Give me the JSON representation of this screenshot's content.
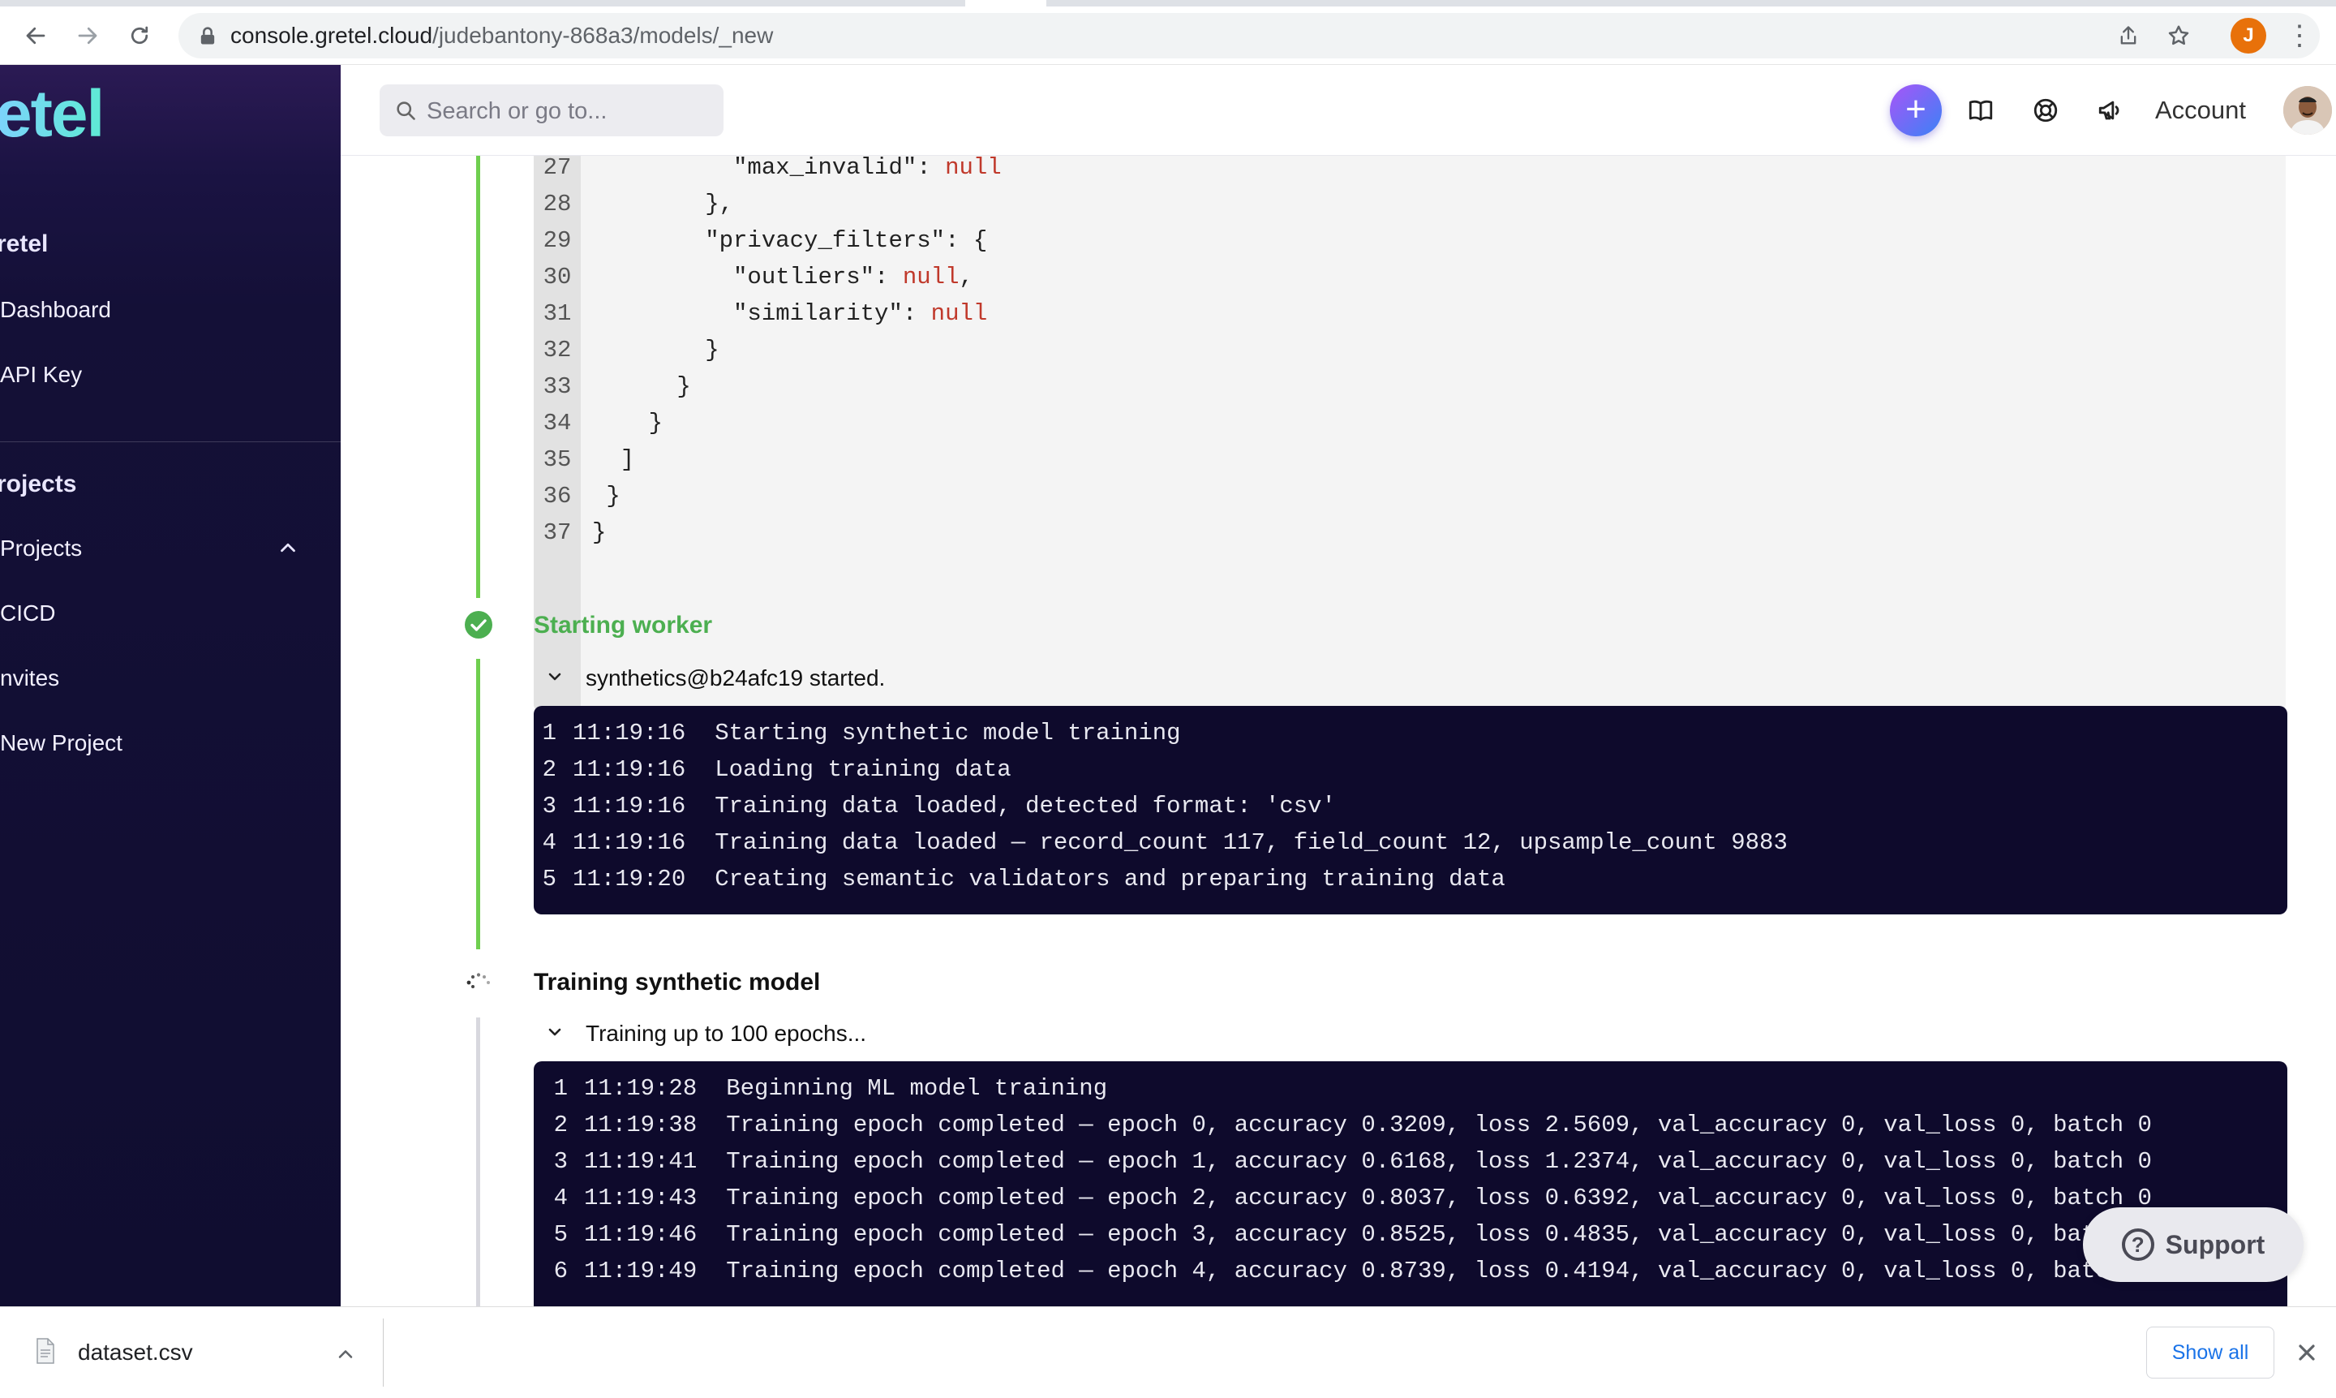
{
  "browser": {
    "url_host": "console.gretel.cloud",
    "url_path": "/judebantony-868a3/models/_new",
    "profile_initial": "J"
  },
  "sidebar": {
    "logo_text": "etel",
    "org_heading": "retel",
    "org_items": [
      "Dashboard",
      "API Key"
    ],
    "projects_heading": "rojects",
    "project_items": [
      "Projects",
      "CICD",
      "nvites",
      "New Project"
    ]
  },
  "header": {
    "search_placeholder": "Search or go to...",
    "plus_label": "+",
    "account_label": "Account"
  },
  "config_code": {
    "lines": [
      {
        "n": "27",
        "pre": "          \"max_invalid\": ",
        "null": "null",
        "post": ""
      },
      {
        "n": "28",
        "pre": "        },",
        "null": "",
        "post": ""
      },
      {
        "n": "29",
        "pre": "        \"privacy_filters\": {",
        "null": "",
        "post": ""
      },
      {
        "n": "30",
        "pre": "          \"outliers\": ",
        "null": "null",
        "post": ","
      },
      {
        "n": "31",
        "pre": "          \"similarity\": ",
        "null": "null",
        "post": ""
      },
      {
        "n": "32",
        "pre": "        }",
        "null": "",
        "post": ""
      },
      {
        "n": "33",
        "pre": "      }",
        "null": "",
        "post": ""
      },
      {
        "n": "34",
        "pre": "    }",
        "null": "",
        "post": ""
      },
      {
        "n": "35",
        "pre": "  ]",
        "null": "",
        "post": ""
      },
      {
        "n": "36",
        "pre": " }",
        "null": "",
        "post": ""
      },
      {
        "n": "37",
        "pre": "}",
        "null": "",
        "post": ""
      }
    ]
  },
  "steps": [
    {
      "title": "Starting worker",
      "status": "complete",
      "color": "#4caf50",
      "subtitle": "synthetics@b24afc19 started.",
      "logs": [
        {
          "n": "1",
          "time": "11:19:16",
          "msg": "Starting synthetic model training"
        },
        {
          "n": "2",
          "time": "11:19:16",
          "msg": "Loading training data"
        },
        {
          "n": "3",
          "time": "11:19:16",
          "msg": "Training data loaded, detected format: 'csv'"
        },
        {
          "n": "4",
          "time": "11:19:16",
          "msg": "Training data loaded — record_count 117, field_count 12, upsample_count 9883"
        },
        {
          "n": "5",
          "time": "11:19:20",
          "msg": "Creating semantic validators and preparing training data"
        }
      ]
    },
    {
      "title": "Training synthetic model",
      "status": "in-progress",
      "color": "#111111",
      "subtitle": "Training up to 100 epochs...",
      "logs": [
        {
          "n": "1",
          "time": "11:19:28",
          "msg": "Beginning ML model training"
        },
        {
          "n": "2",
          "time": "11:19:38",
          "msg": "Training epoch completed — epoch 0, accuracy 0.3209, loss 2.5609, val_accuracy 0, val_loss 0, batch 0"
        },
        {
          "n": "3",
          "time": "11:19:41",
          "msg": "Training epoch completed — epoch 1, accuracy 0.6168, loss 1.2374, val_accuracy 0, val_loss 0, batch 0"
        },
        {
          "n": "4",
          "time": "11:19:43",
          "msg": "Training epoch completed — epoch 2, accuracy 0.8037, loss 0.6392, val_accuracy 0, val_loss 0, batch 0"
        },
        {
          "n": "5",
          "time": "11:19:46",
          "msg": "Training epoch completed — epoch 3, accuracy 0.8525, loss 0.4835, val_accuracy 0, val_loss 0, batch 0"
        },
        {
          "n": "6",
          "time": "11:19:49",
          "msg": "Training epoch completed — epoch 4, accuracy 0.8739, loss 0.4194, val_accuracy 0, val_loss 0, batch 0"
        }
      ]
    }
  ],
  "support": {
    "label": "Support"
  },
  "download": {
    "file_name": "dataset.csv",
    "show_all": "Show all"
  },
  "colors": {
    "accent_green": "#6fcf4f",
    "log_bg": "#0e0a2c",
    "null_red": "#c0392b",
    "link_blue": "#1a73e8"
  }
}
